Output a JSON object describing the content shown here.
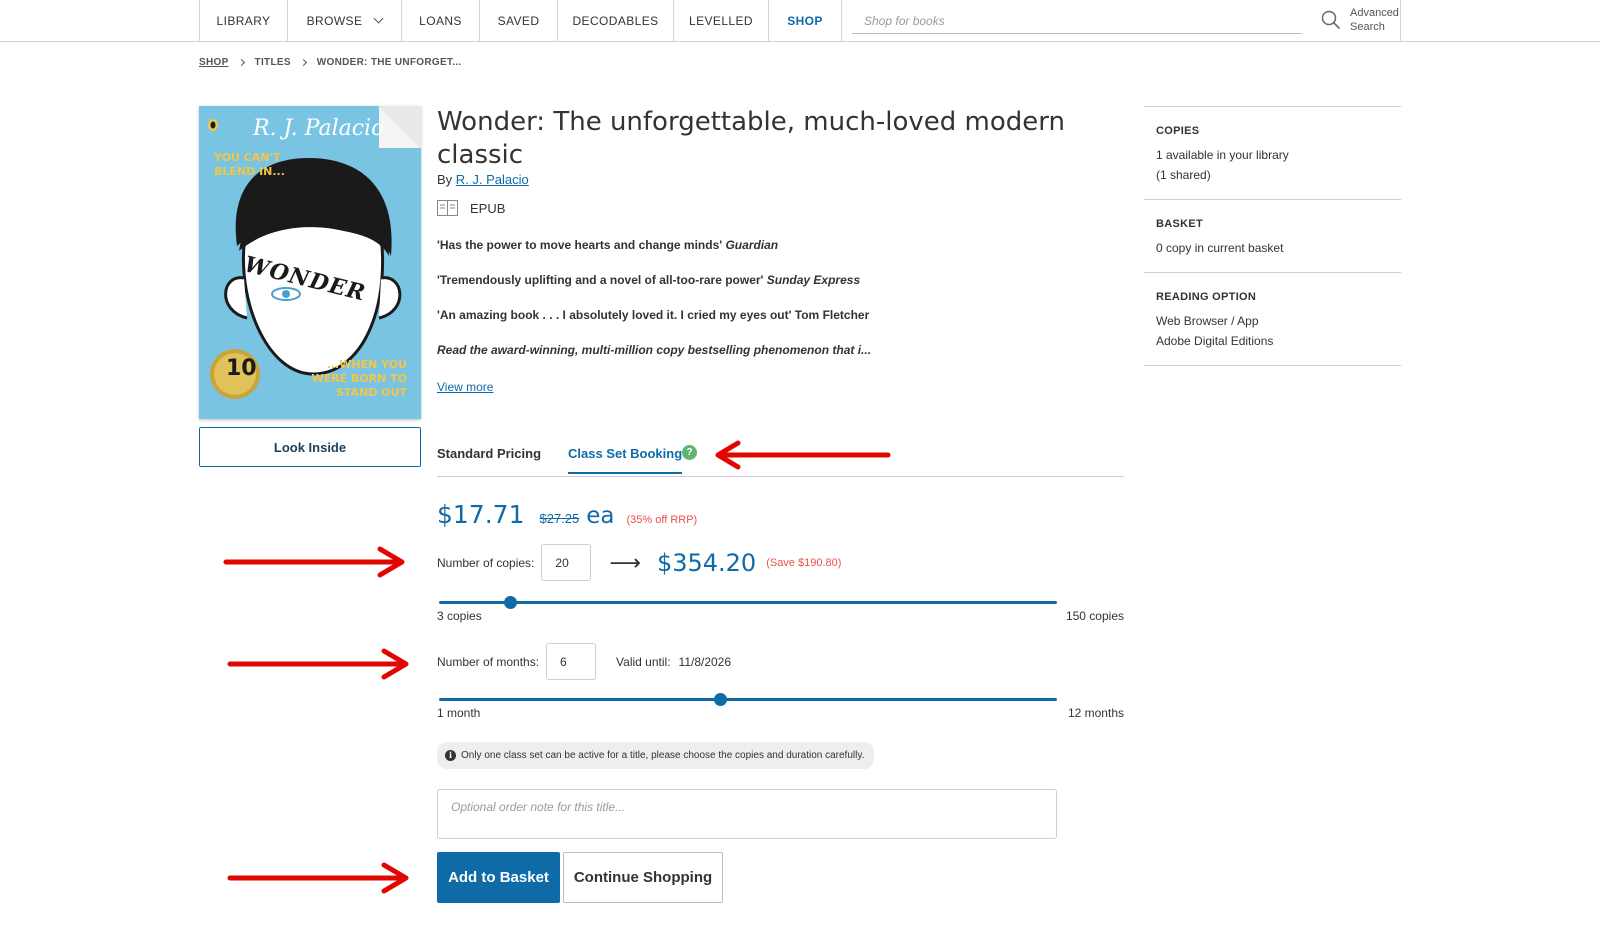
{
  "nav": {
    "items": [
      {
        "label": "LIBRARY",
        "width": 88,
        "active": false
      },
      {
        "label": "BROWSE",
        "width": 114,
        "active": false,
        "dropdown": true
      },
      {
        "label": "LOANS",
        "width": 78,
        "active": false
      },
      {
        "label": "SAVED",
        "width": 78,
        "active": false
      },
      {
        "label": "DECODABLES",
        "width": 116,
        "active": false
      },
      {
        "label": "LEVELLED",
        "width": 95,
        "active": false
      },
      {
        "label": "SHOP",
        "width": 73,
        "active": true
      }
    ],
    "search_placeholder": "Shop for books",
    "advanced_search": "Advanced Search"
  },
  "breadcrumb": {
    "shop": "SHOP",
    "titles": "TITLES",
    "current": "WONDER: THE UNFORGET..."
  },
  "cover": {
    "author": "R. J. Palacio",
    "tagline_top": "YOU CAN'T BLEND IN...",
    "tagline_bottom": "...WHEN YOU WERE BORN TO STAND OUT",
    "title": "WONDER",
    "badge_number": "10",
    "colors": {
      "background": "#79c4e3",
      "accent": "#f2c64b"
    }
  },
  "look_inside": "Look Inside",
  "book": {
    "title": "Wonder: The unforgettable, much-loved modern classic",
    "by": "By",
    "author": "R. J. Palacio",
    "format": "EPUB",
    "quotes": [
      {
        "text": "'Has the power to move hearts and change minds' ",
        "source": "Guardian"
      },
      {
        "text": "'Tremendously uplifting and a novel of all-too-rare power' ",
        "source": "Sunday Express"
      },
      {
        "text": "'An amazing book . . . I absolutely loved it. I cried my eyes out' Tom Fletcher",
        "source": ""
      }
    ],
    "blurb": "Read the award-winning, multi-million copy bestselling phenomenon that i...",
    "view_more": "View more"
  },
  "tabs": {
    "standard": "Standard Pricing",
    "class_set": "Class Set Booking",
    "help": "?"
  },
  "pricing": {
    "price": "$17.71",
    "rrp": "$27.25",
    "unit": "ea",
    "discount": "(35% off RRP)",
    "copies_label": "Number of copies:",
    "copies_value": "20",
    "arrow": "⟶",
    "total": "$354.20",
    "save": "(Save $190.80)",
    "copies_slider": {
      "min": 3,
      "max": 150,
      "value": 20,
      "min_label": "3 copies",
      "max_label": "150 copies"
    },
    "months_label": "Number of months:",
    "months_value": "6",
    "valid_label": "Valid until:",
    "valid_date": "11/8/2026",
    "months_slider": {
      "min": 1,
      "max": 12,
      "value": 6,
      "min_label": "1 month",
      "max_label": "12 months"
    },
    "notice": "Only one class set can be active for a title, please choose the copies and duration carefully.",
    "note_placeholder": "Optional order note for this title..."
  },
  "buttons": {
    "add": "Add to Basket",
    "continue": "Continue Shopping"
  },
  "side": {
    "copies_head": "COPIES",
    "copies_line1": "1 available in your library",
    "copies_line2": "(1 shared)",
    "basket_head": "BASKET",
    "basket_line": "0 copy in current basket",
    "reading_head": "READING OPTION",
    "reading_line1": "Web Browser / App",
    "reading_line2": "Adobe Digital Editions"
  },
  "colors": {
    "accent": "#0e6ba8",
    "red": "#e8524a",
    "annotation": "#e10600",
    "help": "#5fb66e"
  }
}
